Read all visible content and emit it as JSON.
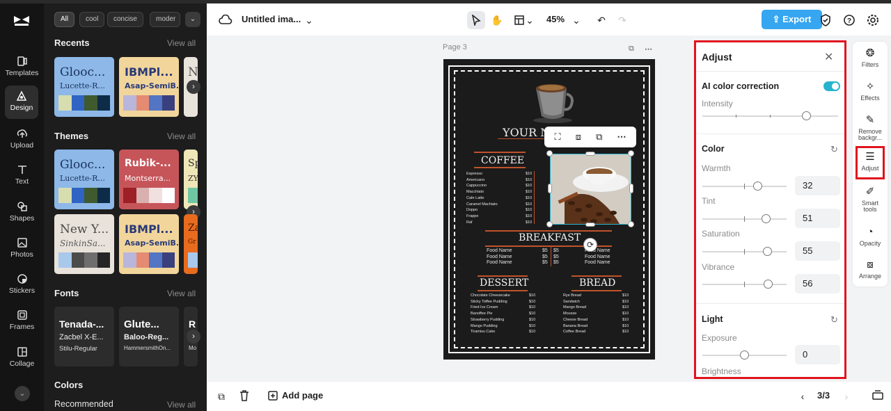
{
  "left_rail": {
    "items": [
      {
        "label": "Templates",
        "icon": "templates-icon"
      },
      {
        "label": "Design",
        "icon": "design-icon"
      },
      {
        "label": "Upload",
        "icon": "upload-icon"
      },
      {
        "label": "Text",
        "icon": "text-icon"
      },
      {
        "label": "Shapes",
        "icon": "shapes-icon"
      },
      {
        "label": "Photos",
        "icon": "photos-icon"
      },
      {
        "label": "Stickers",
        "icon": "stickers-icon"
      },
      {
        "label": "Frames",
        "icon": "frames-icon"
      },
      {
        "label": "Collage",
        "icon": "collage-icon"
      }
    ],
    "active": "Design"
  },
  "side_panel": {
    "chips": [
      "All",
      "cool",
      "concise",
      "moder"
    ],
    "sections": {
      "recents": {
        "title": "Recents",
        "view_all": "View all"
      },
      "themes": {
        "title": "Themes",
        "view_all": "View all"
      },
      "fonts": {
        "title": "Fonts",
        "view_all": "View all"
      },
      "colors": {
        "title": "Colors"
      },
      "recommended": {
        "title": "Recommended",
        "view_all": "View all"
      }
    },
    "recents_cards": [
      {
        "t1": "Glooc...",
        "t2": "Lucette-R...",
        "bg": "#8db8e8",
        "colors": [
          "#d8ddb0",
          "#2f64c4",
          "#3f5a2e",
          "#0e2b47"
        ]
      },
      {
        "t1": "IBMPl...",
        "t2": "Asap-SemiB...",
        "bg": "#f1d59b",
        "colors": [
          "#b9b6dc",
          "#e58b72",
          "#5275c4",
          "#3a3f7e"
        ]
      },
      {
        "t1": "N",
        "t2": "",
        "bg": "#e8e4dc",
        "colors": [
          "#9ab",
          "#789"
        ]
      }
    ],
    "theme_cards": [
      {
        "t1": "Glooc...",
        "t2": "Lucette-R...",
        "bg": "#8db8e8",
        "colors": [
          "#d8ddb0",
          "#2f64c4",
          "#3f5a2e",
          "#0e2b47"
        ]
      },
      {
        "t1": "Rubik-...",
        "t2": "Montserra...",
        "bg": "#c6555a",
        "colors": [
          "#9c2025",
          "#d8b0b0",
          "#f1e0e0",
          "#ffffff"
        ]
      },
      {
        "t1": "Sp",
        "t2": "ZY",
        "bg": "#efe7b8",
        "colors": [
          "#6fc6a3"
        ]
      },
      {
        "t1": "New Y...",
        "t2": "SinkinSa...",
        "bg": "#e8e2da",
        "colors": [
          "#a8c8ec",
          "#4b4b4b",
          "#6e6e6e",
          "#262626"
        ]
      },
      {
        "t1": "IBMPl...",
        "t2": "Asap-SemiB...",
        "bg": "#f1d59b",
        "colors": [
          "#b9b6dc",
          "#e58b72",
          "#5275c4",
          "#3a3f7e"
        ]
      },
      {
        "t1": "Za",
        "t2": "Gr",
        "bg": "#e96b1e",
        "colors": [
          "#a8c8ec"
        ]
      }
    ],
    "font_cards": [
      {
        "a": "Tenada-...",
        "b": "Zacbel X-E...",
        "c": "Stilu-Regular"
      },
      {
        "a": "Glute...",
        "b": "Baloo-Reg...",
        "c": "HammersmithOn..."
      },
      {
        "a": "R",
        "b": "",
        "c": "Mo"
      }
    ]
  },
  "topbar": {
    "title": "Untitled ima...",
    "zoom": "45%",
    "export_label": "Export"
  },
  "canvas": {
    "page_label": "Page 3",
    "menu": {
      "heading": "YOUR N",
      "coffee_title": "COFFEE",
      "coffee_items": "Espresso\nAmericano\nCappuccino\nMacchiato\nCafe Latte\nCaramel Machiato\nDoppo\nFrappe\nRaf",
      "coffee_prices": "$10\n$10\n$10\n$10\n$10\n$10\n$10\n$10\n$10",
      "breakfast_title": "BREAKFAST",
      "breakfast_left": "Food Name\nFood Name\nFood Name",
      "breakfast_prices": "$5\n$5\n$5",
      "breakfast_prices_right": "$5\n$5\n$5",
      "breakfast_right": "Food Name\nFood Name\nFood Name",
      "dessert_title": "DESSERT",
      "dessert_items": "Chocolate Cheesecake\nSticky Toffee Pudding\nFried Ice Cream\nBanoffee Pie\nStrawberry Pudding\nMango Pudding\nTiramisu Cake",
      "dessert_prices": "$10\n$10\n$10\n$10\n$10\n$10\n$10",
      "bread_title": "BREAD",
      "bread_items": "Rye Bread\nSandwich\nMango Bread\nMousse\nCheese Bread\nBanana Bread\nCoffee Bread",
      "bread_prices": "$10\n$10\n$10\n$10\n$10\n$10\n$10"
    }
  },
  "bottombar": {
    "add_page": "Add page",
    "page_indicator": "3/3"
  },
  "adjust_panel": {
    "title": "Adjust",
    "ai_label": "AI color correction",
    "ai_enabled": true,
    "intensity_label": "Intensity",
    "intensity": 0.5,
    "color_heading": "Color",
    "warmth_label": "Warmth",
    "warmth": "32",
    "tint_label": "Tint",
    "tint": "51",
    "saturation_label": "Saturation",
    "saturation": "55",
    "vibrance_label": "Vibrance",
    "vibrance": "56",
    "light_heading": "Light",
    "exposure_label": "Exposure",
    "exposure": "0",
    "brightness_label": "Brightness"
  },
  "tool_rail": {
    "items": [
      {
        "label": "Filters",
        "icon": "filters-icon"
      },
      {
        "label": "Effects",
        "icon": "effects-icon"
      },
      {
        "label": "Remove backgr...",
        "icon": "remove-background-icon"
      },
      {
        "label": "Adjust",
        "icon": "adjust-icon"
      },
      {
        "label": "Smart tools",
        "icon": "smart-tools-icon"
      },
      {
        "label": "Opacity",
        "icon": "opacity-icon"
      },
      {
        "label": "Arrange",
        "icon": "arrange-icon"
      }
    ],
    "active": "Adjust"
  },
  "colors": {
    "accent": "#36a6f1",
    "selection": "#2bb5d6",
    "highlight": "#e0141e",
    "panel_dark": "#1d1d1d"
  }
}
